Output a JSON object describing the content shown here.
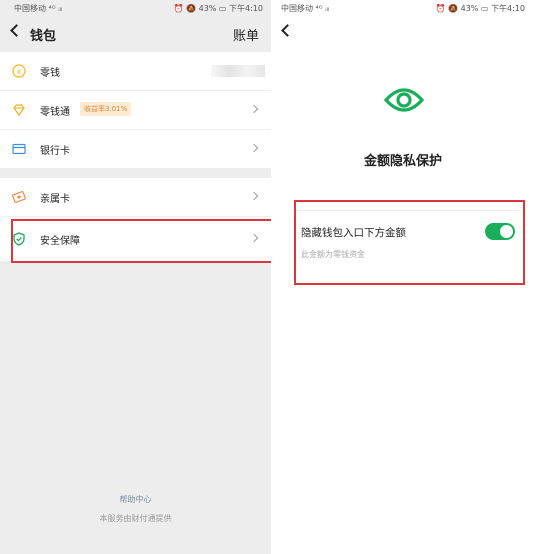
{
  "status_bar": {
    "left": "中国移动 ⁴ᴳ ᵢₗₗ",
    "right": "⏰ 🔕 43% ▭ 下午4:10"
  },
  "wallet": {
    "title": "钱包",
    "bill_link": "账单",
    "items": [
      {
        "label": "零钱",
        "icon": "coin-icon"
      },
      {
        "label": "零钱通",
        "badge": "收益率3.01%",
        "icon": "diamond-icon"
      },
      {
        "label": "银行卡",
        "icon": "card-icon"
      },
      {
        "label": "亲属卡",
        "icon": "family-card-icon"
      },
      {
        "label": "安全保障",
        "icon": "shield-icon"
      }
    ],
    "help_center": "帮助中心",
    "provider_note": "本服务由财付通提供"
  },
  "privacy": {
    "title": "金额隐私保护",
    "setting_label": "隐藏钱包入口下方金额",
    "setting_desc": "此金额为零钱资金",
    "toggle_on": true
  },
  "colors": {
    "accent_green": "#1aad5a",
    "highlight_red": "#d9363e",
    "badge_orange": "#e08a3c",
    "coin_yellow": "#f5c242"
  }
}
